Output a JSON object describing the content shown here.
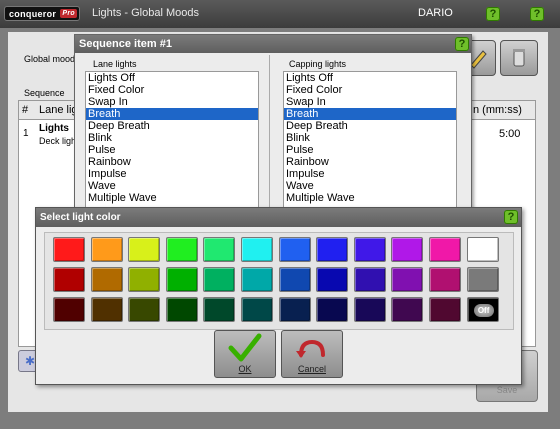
{
  "titlebar": {
    "logo_text": "conqueror",
    "logo_badge": "Pro",
    "title": "Lights - Global Moods",
    "user": "DARIO",
    "help_glyph": "?"
  },
  "background": {
    "global_mood_label": "Global mood",
    "sequence_label": "Sequence",
    "table": {
      "headers": [
        "#",
        "Lane lig",
        "n (mm:ss)"
      ],
      "rows": [
        {
          "index": "1",
          "lane": "Lights",
          "sub": "Deck ligh",
          "duration": "5:00"
        }
      ]
    },
    "save_label": "Save"
  },
  "sequence_dialog": {
    "title": "Sequence item #1",
    "lane_label": "Lane lights",
    "capping_label": "Capping lights",
    "lane_items": [
      "Lights Off",
      "Fixed Color",
      "Swap In",
      "Breath",
      "Deep Breath",
      "Blink",
      "Pulse",
      "Rainbow",
      "Impulse",
      "Wave",
      "Multiple Wave"
    ],
    "lane_selected": "Breath",
    "capping_items": [
      "Lights Off",
      "Fixed Color",
      "Swap In",
      "Breath",
      "Deep Breath",
      "Blink",
      "Pulse",
      "Rainbow",
      "Impulse",
      "Wave",
      "Multiple Wave"
    ],
    "capping_selected": "Breath"
  },
  "color_dialog": {
    "title": "Select light color",
    "rows": [
      [
        "#ff1a1a",
        "#ff9a1a",
        "#d8f01a",
        "#20ee20",
        "#20e870",
        "#20f0f0",
        "#2060f0",
        "#2020f0",
        "#4018e8",
        "#b018e8",
        "#f018a8",
        "#ffffff"
      ],
      [
        "#b00000",
        "#b06a00",
        "#90b000",
        "#00b000",
        "#00b060",
        "#00a8a8",
        "#1048b0",
        "#0808b0",
        "#3010b0",
        "#8010b0",
        "#b01070",
        "#7a7a7a"
      ],
      [
        "#500000",
        "#503000",
        "#384800",
        "#004800",
        "#00482a",
        "#004848",
        "#082050",
        "#080850",
        "#180858",
        "#400850",
        "#500830",
        "off"
      ]
    ],
    "off_label": "Off",
    "ok_label": "OK",
    "cancel_label": "Cancel"
  },
  "colors": {
    "selection": "#1e66c8",
    "titlebar": "#4a4a4a",
    "help_green": "#6fbf2a",
    "ok_check": "#38b000",
    "cancel_arrow": "#c0282d"
  }
}
